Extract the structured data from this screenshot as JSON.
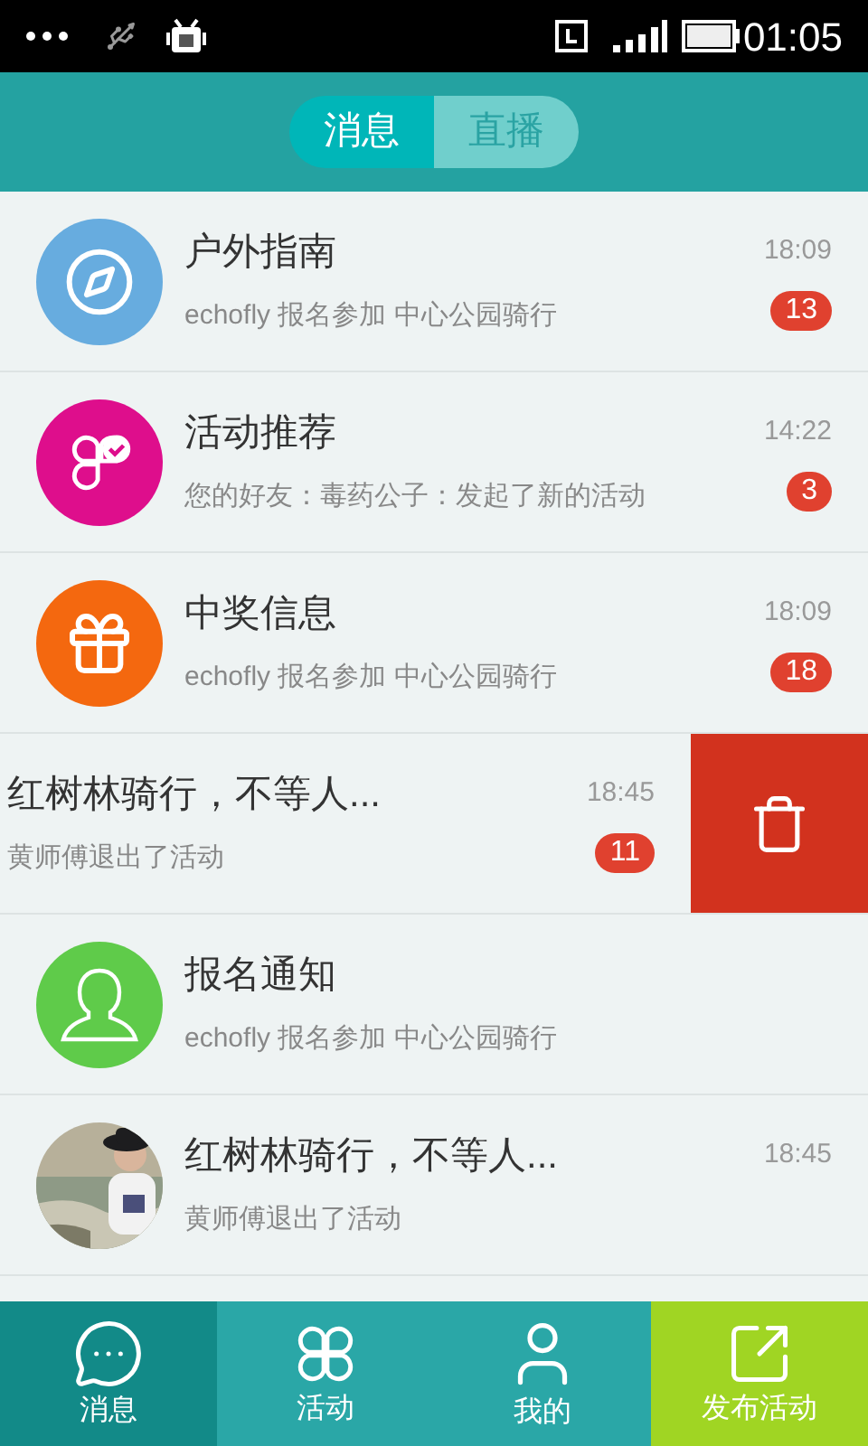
{
  "status_bar": {
    "time": "01:05"
  },
  "header": {
    "tabs": [
      {
        "label": "消息",
        "selected": true
      },
      {
        "label": "直播",
        "selected": false
      }
    ]
  },
  "messages": [
    {
      "kind": "compass",
      "color": "#67acdf",
      "title": "户外指南",
      "subtitle": "echofly 报名参加 中心公园骑行",
      "time": "18:09",
      "badge": "13",
      "swiped": false
    },
    {
      "kind": "clover",
      "color": "#de0e8c",
      "title": "活动推荐",
      "subtitle": "您的好友：毒药公子：发起了新的活动",
      "time": "14:22",
      "badge": "3",
      "swiped": false
    },
    {
      "kind": "gift",
      "color": "#f4680f",
      "title": "中奖信息",
      "subtitle": "echofly 报名参加 中心公园骑行",
      "time": "18:09",
      "badge": "18",
      "swiped": false
    },
    {
      "title": "红树林骑行，不等人...",
      "subtitle": "黄师傅退出了活动",
      "time": "18:45",
      "badge": "11",
      "swiped": true
    },
    {
      "kind": "person",
      "color": "#5fcb4a",
      "title": "报名通知",
      "subtitle": "echofly 报名参加 中心公园骑行",
      "swiped": false
    },
    {
      "title": "红树林骑行，不等人...",
      "subtitle": "黄师傅退出了活动",
      "time": "18:45",
      "swiped": false
    }
  ],
  "tab_bar": [
    {
      "label": "消息",
      "kind": "chat",
      "selected": true
    },
    {
      "label": "活动",
      "kind": "clover",
      "selected": false
    },
    {
      "label": "我的",
      "kind": "user",
      "selected": false
    },
    {
      "label": "发布活动",
      "kind": "publish",
      "selected": false
    }
  ]
}
